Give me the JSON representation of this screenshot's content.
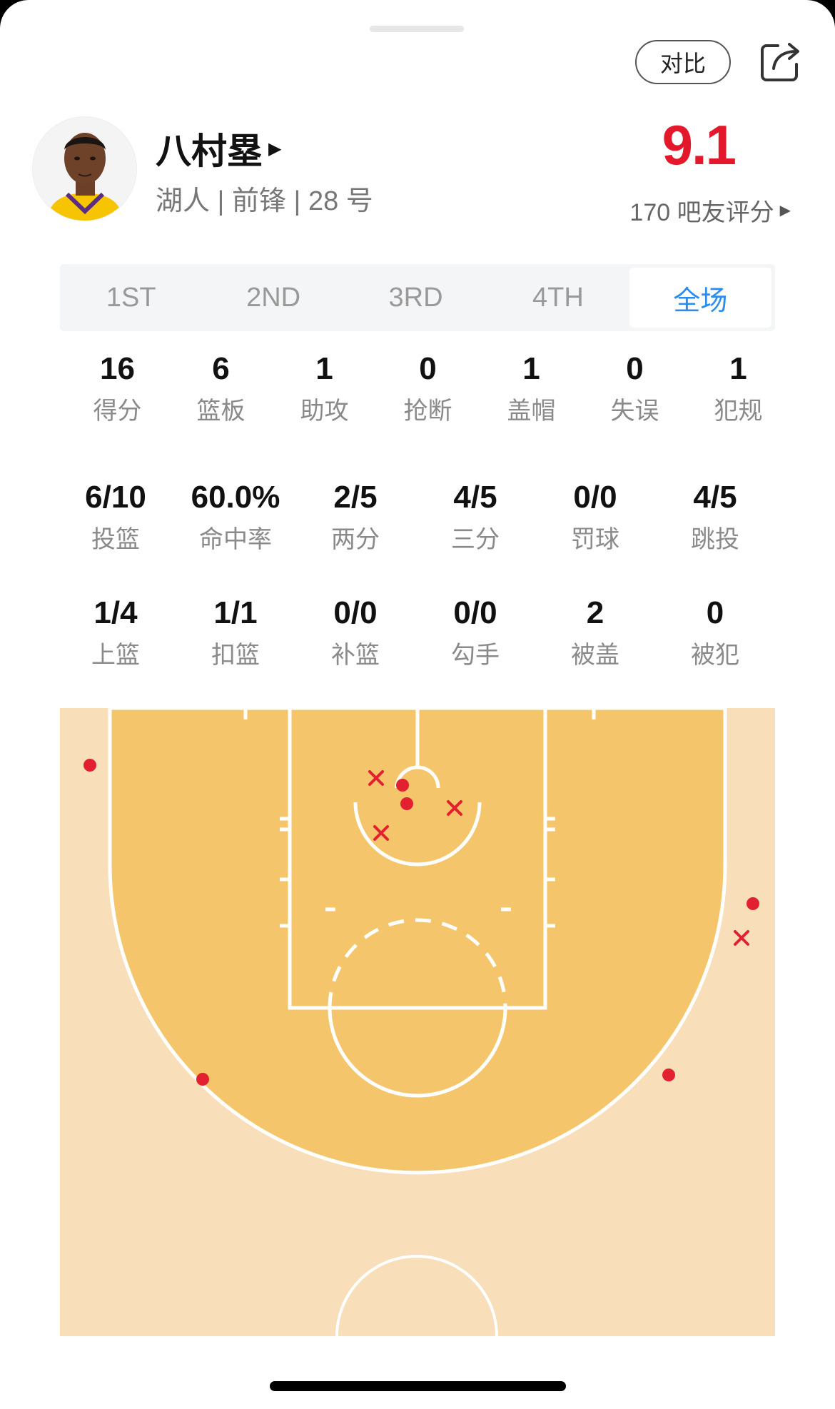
{
  "header": {
    "compare_label": "对比",
    "share_icon": "share-icon"
  },
  "player": {
    "name": "八村塁",
    "meta": "湖人 | 前锋 | 28 号",
    "rating": "9.1",
    "rating_count": "170 吧友评分"
  },
  "periods": [
    {
      "label": "1ST",
      "active": false
    },
    {
      "label": "2ND",
      "active": false
    },
    {
      "label": "3RD",
      "active": false
    },
    {
      "label": "4TH",
      "active": false
    },
    {
      "label": "全场",
      "active": true
    }
  ],
  "stats_basic": [
    {
      "value": "16",
      "label": "得分"
    },
    {
      "value": "6",
      "label": "篮板"
    },
    {
      "value": "1",
      "label": "助攻"
    },
    {
      "value": "0",
      "label": "抢断"
    },
    {
      "value": "1",
      "label": "盖帽"
    },
    {
      "value": "0",
      "label": "失误"
    },
    {
      "value": "1",
      "label": "犯规"
    }
  ],
  "stats_shooting": [
    {
      "value": "6/10",
      "label": "投篮"
    },
    {
      "value": "60.0%",
      "label": "命中率"
    },
    {
      "value": "2/5",
      "label": "两分"
    },
    {
      "value": "4/5",
      "label": "三分"
    },
    {
      "value": "0/0",
      "label": "罚球"
    },
    {
      "value": "4/5",
      "label": "跳投"
    }
  ],
  "stats_detail": [
    {
      "value": "1/4",
      "label": "上篮"
    },
    {
      "value": "1/1",
      "label": "扣篮"
    },
    {
      "value": "0/0",
      "label": "补篮"
    },
    {
      "value": "0/0",
      "label": "勾手"
    },
    {
      "value": "2",
      "label": "被盖"
    },
    {
      "value": "0",
      "label": "被犯"
    }
  ],
  "shot_chart": {
    "made_color": "#e3202f",
    "missed_color": "#e3202f",
    "court_light": "#f8dfba",
    "court_dark": "#f5c56c"
  }
}
